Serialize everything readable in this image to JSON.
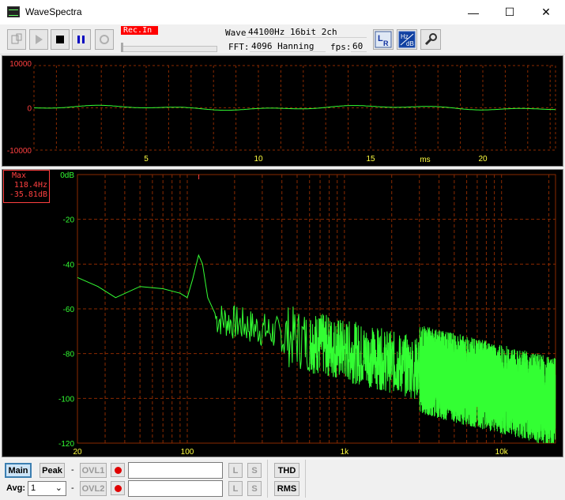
{
  "window": {
    "title": "WaveSpectra",
    "minimize": "—",
    "maximize": "☐",
    "close": "✕"
  },
  "toolbar": {
    "rec_in": "Rec.In",
    "wave_label": "Wave:",
    "wave_value": "44100Hz 16bit 2ch",
    "fft_label": "FFT:",
    "fft_value": "4096 Hanning",
    "fps_label": "fps:",
    "fps_value": "60",
    "lr_button": "LR",
    "hzdb_top": "Hz",
    "hzdb_bottom": "dB",
    "icons": [
      "device-icon",
      "play-icon",
      "stop-icon",
      "pause-icon",
      "record-loop-icon",
      "lr-icon",
      "hz-db-icon",
      "wrench-icon"
    ]
  },
  "wave_panel": {
    "y_ticks": [
      "10000",
      "0",
      "-10000"
    ],
    "x_ticks": [
      "5",
      "10",
      "15",
      "20"
    ],
    "x_unit": "ms",
    "colors": {
      "grid": "#8a2a00",
      "trace": "#33ff33",
      "axis_text": "#ff4040",
      "x_text": "#ffff40"
    }
  },
  "spectrum_panel": {
    "max_label": "Max",
    "max_freq": "118.4Hz",
    "max_db": "-35.81dB",
    "y_ticks": [
      "0dB",
      "-20",
      "-40",
      "-60",
      "-80",
      "-100",
      "-120"
    ],
    "x_ticks": [
      "20",
      "100",
      "1k",
      "10k"
    ],
    "colors": {
      "grid": "#8a2a00",
      "trace": "#33ff33",
      "y_text": "#33ff33",
      "x_text": "#ffff40"
    }
  },
  "bottom": {
    "main": "Main",
    "peak": "Peak",
    "avg_label": "Avg:",
    "avg_value": "1",
    "dash": "-",
    "ovl1": "OVL1",
    "ovl2": "OVL2",
    "l": "L",
    "s": "S",
    "thd": "THD",
    "rms": "RMS"
  }
}
